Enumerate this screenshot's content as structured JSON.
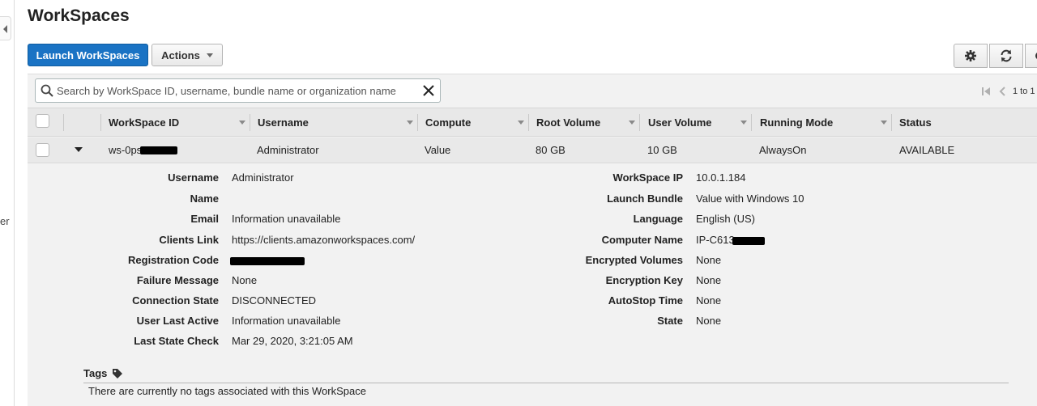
{
  "nav": {
    "cut_text": "er"
  },
  "page_title": "WorkSpaces",
  "toolbar": {
    "launch_label": "Launch WorkSpaces",
    "actions_label": "Actions",
    "icons": [
      "gear-icon",
      "refresh-icon",
      "more-icon"
    ]
  },
  "search": {
    "placeholder": "Search by WorkSpace ID, username, bundle name or organization name",
    "value": ""
  },
  "pager": {
    "range_text": "1 to 1"
  },
  "table": {
    "columns": [
      "WorkSpace ID",
      "Username",
      "Compute",
      "Root Volume",
      "User Volume",
      "Running Mode",
      "Status"
    ],
    "rows": [
      {
        "id": "ws-0ps",
        "username": "Administrator",
        "compute": "Value",
        "root_volume": "80 GB",
        "user_volume": "10 GB",
        "running_mode": "AlwaysOn",
        "status": "AVAILABLE"
      }
    ]
  },
  "details": {
    "left": [
      {
        "label": "Username",
        "value": "Administrator"
      },
      {
        "label": "Name",
        "value": ""
      },
      {
        "label": "Email",
        "value": "Information unavailable"
      },
      {
        "label": "Clients Link",
        "value": "https://clients.amazonworkspaces.com/"
      },
      {
        "label": "Registration Code",
        "value": ""
      },
      {
        "label": "Failure Message",
        "value": "None"
      },
      {
        "label": "Connection State",
        "value": "DISCONNECTED"
      },
      {
        "label": "User Last Active",
        "value": "Information unavailable"
      },
      {
        "label": "Last State Check",
        "value": "Mar 29, 2020, 3:21:05 AM"
      }
    ],
    "right": [
      {
        "label": "WorkSpace IP",
        "value": "10.0.1.184"
      },
      {
        "label": "Launch Bundle",
        "value": "Value with Windows 10"
      },
      {
        "label": "Language",
        "value": "English (US)"
      },
      {
        "label": "Computer Name",
        "value": "IP-C613"
      },
      {
        "label": "Encrypted Volumes",
        "value": "None"
      },
      {
        "label": "Encryption Key",
        "value": "None"
      },
      {
        "label": "AutoStop Time",
        "value": "None"
      },
      {
        "label": "State",
        "value": "None"
      }
    ]
  },
  "tags": {
    "title": "Tags",
    "empty_text": "There are currently no tags associated with this WorkSpace"
  },
  "colors": {
    "primary": "#1a73c4",
    "status_available": "#1d8102",
    "panel_bg": "#f2f2f2"
  }
}
